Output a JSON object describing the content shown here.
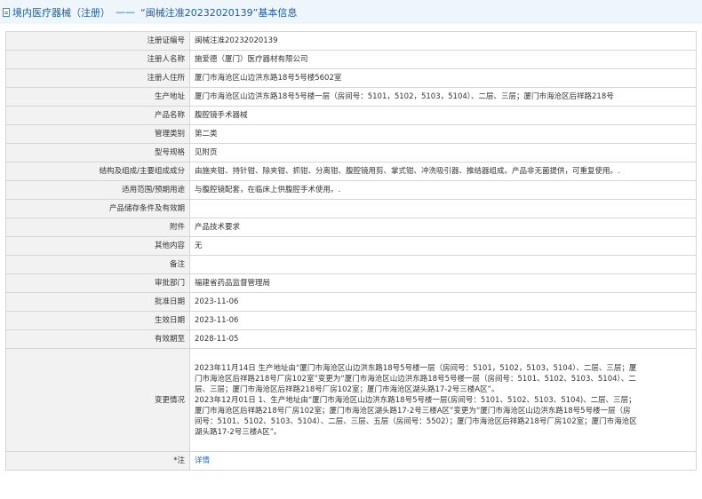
{
  "header": {
    "category": "境内医疗器械（注册）",
    "separator": "——",
    "title": "“闽械注准20232020139”基本信息"
  },
  "rows": [
    {
      "label": "注册证编号",
      "value": "闽械注准20232020139"
    },
    {
      "label": "注册人名称",
      "value": "施爱德（厦门）医疗器材有限公司"
    },
    {
      "label": "注册人住所",
      "value": "厦门市海沧区山边洪东路18号5号楼5602室"
    },
    {
      "label": "生产地址",
      "value": "厦门市海沧区山边洪东路18号5号楼一层（房间号：5101，5102，5103，5104）、二层、三层；厦门市海沧区后祥路218号"
    },
    {
      "label": "产品名称",
      "value": "腹腔镜手术器械"
    },
    {
      "label": "管理类别",
      "value": "第二类"
    },
    {
      "label": "型号规格",
      "value": "见附页"
    },
    {
      "label": "结构及组成/主要组成成分",
      "value": "由施夹钳、持针钳、除夹钳、抓钳、分离钳、腹腔镜用剪、掌式钳、冲洗吸引器、推结器组成。产品非无菌提供，可重复使用。."
    },
    {
      "label": "适用范围/预期用途",
      "value": "与腹腔镜配套，在临床上供腹腔手术使用。."
    },
    {
      "label": "产品储存条件及有效期",
      "value": ""
    },
    {
      "label": "附件",
      "value": "产品技术要求"
    },
    {
      "label": "其他内容",
      "value": "无"
    },
    {
      "label": "备注",
      "value": ""
    },
    {
      "label": "审批部门",
      "value": "福建省药品监督管理局"
    },
    {
      "label": "批准日期",
      "value": "2023-11-06"
    },
    {
      "label": "生效日期",
      "value": "2023-11-06"
    },
    {
      "label": "有效期至",
      "value": "2028-11-05"
    }
  ],
  "changes": {
    "label": "变更情况",
    "lines": [
      "2023年11月14日 生产地址由“厦门市海沧区山边洪东路18号5号楼一层（房间号：5101，5102，5103，5104）、二层、三层；厦",
      "门市海沧区后祥路218号厂房102室”变更为“厦门市海沧区山边洪东路18号5号楼一层（房间号：5101、5102、5103、5104）、二",
      "层、三层；厦门市海沧区后祥路218号厂房102室；厦门市海沧区湖头路17-2号三楼A区”。",
      "2023年12月01日 1、生产地址由“厦门市海沧区山边洪东路18号5号楼一层(房间号：5101、5102、5103、5104)、二层、三层；",
      "厦门市海沧区后祥路218号厂房102室；厦门市海沧区湖头路17-2号三楼A区”变更为“厦门市海沧区山边洪东路18号5号楼一层（房",
      "间号：5101、5102、5103、5104）、二层、三层、五层（房间号：5502）；厦门市海沧区后祥路218号厂房102室；厦门市海沧区",
      "湖头路17-2号三楼A区”。"
    ]
  },
  "note": {
    "label": "*注",
    "link": "详情"
  },
  "colors": {
    "header_bg": "#eef5fb",
    "header_text": "#1d5fa0",
    "label_bg": "#f2f2f2",
    "border": "#d6d6d6",
    "link": "#1a6fc4"
  }
}
